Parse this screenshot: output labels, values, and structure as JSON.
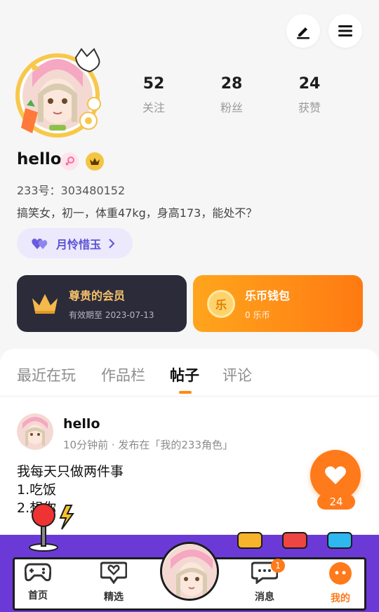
{
  "header": {
    "edit_icon": "edit-pen-icon",
    "menu_icon": "menu-icon"
  },
  "profile": {
    "stats": [
      {
        "value": "52",
        "label": "关注"
      },
      {
        "value": "28",
        "label": "粉丝"
      },
      {
        "value": "24",
        "label": "获赞"
      }
    ],
    "username": "hello",
    "uid": "233号：303480152",
    "bio": "搞笑女，初一，体重47kg，身高173，能处不？",
    "cp_label": "月怜惜玉"
  },
  "cards": {
    "vip": {
      "title": "尊贵的会员",
      "subtitle": "有效期至 2023-07-13"
    },
    "wallet": {
      "title": "乐币钱包",
      "subtitle": "0 乐币",
      "coin_glyph": "乐"
    }
  },
  "tabs": [
    {
      "label": "最近在玩",
      "active": false
    },
    {
      "label": "作品栏",
      "active": false
    },
    {
      "label": "帖子",
      "active": true
    },
    {
      "label": "评论",
      "active": false
    }
  ],
  "post": {
    "author": "hello",
    "meta": "10分钟前 · 发布在「我的233角色」",
    "body": "我每天只做两件事\n1.吃饭\n2.想你",
    "likes": "24"
  },
  "bottom_nav": {
    "items": [
      {
        "label": "首页",
        "icon": "gamepad-icon",
        "active": false
      },
      {
        "label": "精选",
        "icon": "heart-box-icon",
        "active": false
      },
      {
        "label": "消息",
        "icon": "chat-icon",
        "active": false
      },
      {
        "label": "我的",
        "icon": "smile-icon",
        "active": true
      }
    ],
    "message_badge": "1"
  },
  "colors": {
    "accent": "#ff7a1a",
    "purple": "#6b3ad6",
    "cp_text": "#5b53d6"
  }
}
